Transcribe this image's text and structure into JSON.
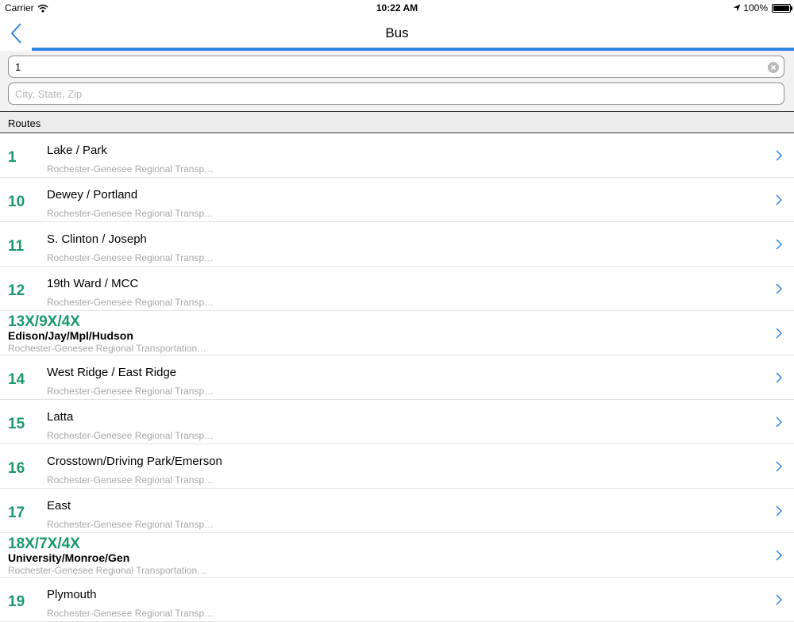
{
  "status": {
    "carrier": "Carrier",
    "time": "10:22 AM",
    "battery": "100%"
  },
  "nav": {
    "title": "Bus",
    "progress": 1.0
  },
  "search": {
    "route_value": "1",
    "city_placeholder": "City, State, Zip"
  },
  "section": {
    "title": "Routes"
  },
  "routes": [
    {
      "number": "1",
      "name": "Lake / Park",
      "agency": "Rochester-Genesee Regional Transp…"
    },
    {
      "number": "10",
      "name": "Dewey / Portland",
      "agency": "Rochester-Genesee Regional Transp…"
    },
    {
      "number": "11",
      "name": "S. Clinton / Joseph",
      "agency": "Rochester-Genesee Regional Transp…"
    },
    {
      "number": "12",
      "name": "19th Ward / MCC",
      "agency": "Rochester-Genesee Regional Transp…"
    },
    {
      "number": "13X/9X/4X",
      "name": "Edison/Jay/Mpl/Hudson",
      "agency": "Rochester-Genesee Regional Transportation…"
    },
    {
      "number": "14",
      "name": "West Ridge / East Ridge",
      "agency": "Rochester-Genesee Regional Transp…"
    },
    {
      "number": "15",
      "name": "Latta",
      "agency": "Rochester-Genesee Regional Transp…"
    },
    {
      "number": "16",
      "name": "Crosstown/Driving Park/Emerson",
      "agency": "Rochester-Genesee Regional Transp…"
    },
    {
      "number": "17",
      "name": "East",
      "agency": "Rochester-Genesee Regional Transp…"
    },
    {
      "number": "18X/7X/4X",
      "name": "University/Monroe/Gen",
      "agency": "Rochester-Genesee Regional Transportation…"
    },
    {
      "number": "19",
      "name": "Plymouth",
      "agency": "Rochester-Genesee Regional Transp…"
    }
  ],
  "icons": {
    "back": "chevron-left-icon",
    "clear": "clear-circle-icon",
    "disclosure": "chevron-right-icon",
    "wifi": "wifi-icon",
    "location": "location-arrow-icon",
    "battery": "battery-icon"
  },
  "colors": {
    "accent": "#2f86e0",
    "route_number": "#1a9a6a"
  }
}
